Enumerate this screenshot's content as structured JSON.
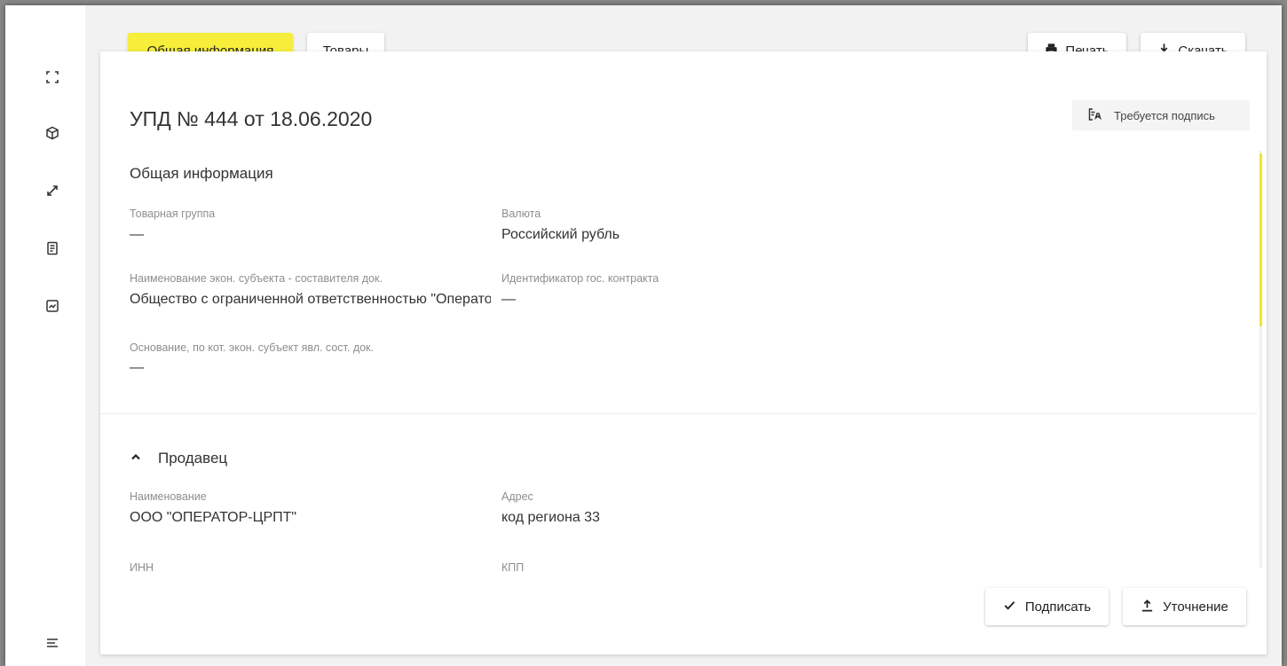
{
  "tabs": {
    "general": "Общая информация",
    "goods": "Товары"
  },
  "toolbar": {
    "print_label": "Печать",
    "download_label": "Скачать"
  },
  "document": {
    "title": "УПД № 444 от 18.06.2020",
    "status_badge": "Требуется подпись"
  },
  "general_info": {
    "section_title": "Общая информация",
    "fields": [
      {
        "label": "Товарная группа",
        "value": "—"
      },
      {
        "label": "Валюта",
        "value": "Российский рубль"
      },
      {
        "label": "Наименование экон. субъекта - составителя док.",
        "value": "Общество с ограниченной ответственностью \"Оператор-ЦРПТ\""
      },
      {
        "label": "Идентификатор гос. контракта",
        "value": "—"
      },
      {
        "label": "Основание, по кот. экон. субъект явл. сост. док.",
        "value": "—"
      }
    ]
  },
  "seller": {
    "section_title": "Продавец",
    "fields": [
      {
        "label": "Наименование",
        "value": "ООО \"ОПЕРАТОР-ЦРПТ\""
      },
      {
        "label": "Адрес",
        "value": "код региона 33"
      },
      {
        "label": "ИНН",
        "value": ""
      },
      {
        "label": "КПП",
        "value": ""
      }
    ]
  },
  "actions": {
    "sign_label": "Подписать",
    "clarify_label": "Уточнение"
  },
  "sidebar": {
    "icons": [
      "scan-icon",
      "box-icon",
      "transfer-icon",
      "document-icon",
      "report-icon",
      "menu-icon"
    ]
  },
  "colors": {
    "accent": "#f6ee3a",
    "scroll_thumb": "#f4e52a",
    "text_primary": "#333333",
    "text_secondary": "#8e8e8e"
  }
}
